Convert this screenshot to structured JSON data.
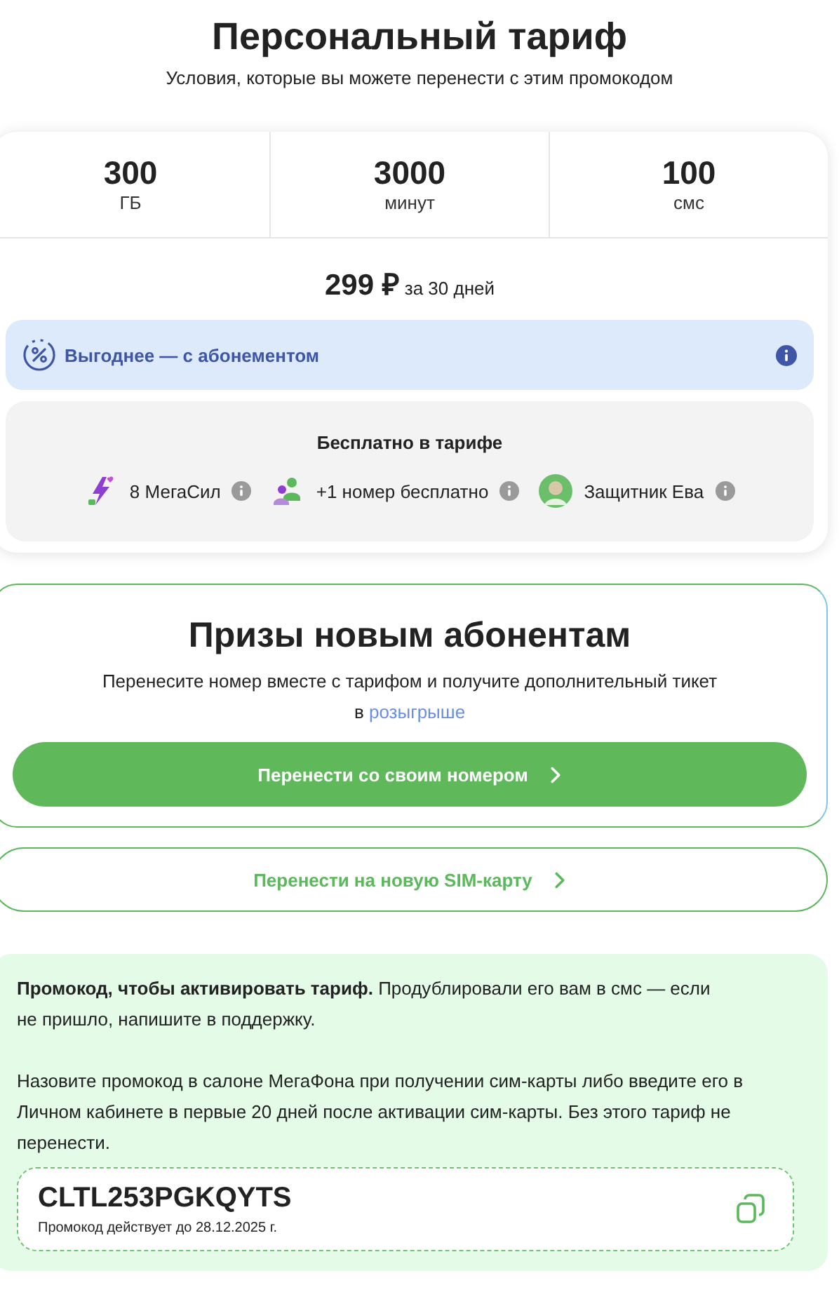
{
  "header": {
    "title": "Персональный тариф",
    "subtitle": "Условия, которые вы можете перенести с этим промокодом"
  },
  "tariff": {
    "stats": [
      {
        "value": "300",
        "unit": "ГБ"
      },
      {
        "value": "3000",
        "unit": "минут"
      },
      {
        "value": "100",
        "unit": "смс"
      }
    ],
    "price": "299 ₽",
    "period": "за 30 дней",
    "subscription_banner": "Выгоднее — с абонементом",
    "free": {
      "title": "Бесплатно в тарифе",
      "items": [
        {
          "kind": "power",
          "label": "8 МегаСил"
        },
        {
          "kind": "people",
          "label": "+1 номер бесплатно"
        },
        {
          "kind": "avatar",
          "label": "Защитник Ева"
        }
      ]
    }
  },
  "prizes": {
    "title": "Призы новым абонентам",
    "text": "Перенесите номер вместе с тарифом и получите дополнительный тикет",
    "text_prefix": "в",
    "link": "розыгрыше",
    "primary_button": "Перенести со своим номером"
  },
  "secondary_button": "Перенести на новую SIM-карту",
  "promo": {
    "paragraph_1": "**Промокод, чтобы активировать тариф.** Продублировали его вам в смс — если не пришло, напишите в поддержку.",
    "paragraph_2": "Назовите промокод в салоне МегаФона при получении сим-карты либо введите его в Личном кабинете в первые 20 дней после активации сим-карты. Без этого тариф не перенести.",
    "code": "CLTL253PGKQYTS",
    "validity": "Промокод действует до 28.12.2025 г."
  }
}
